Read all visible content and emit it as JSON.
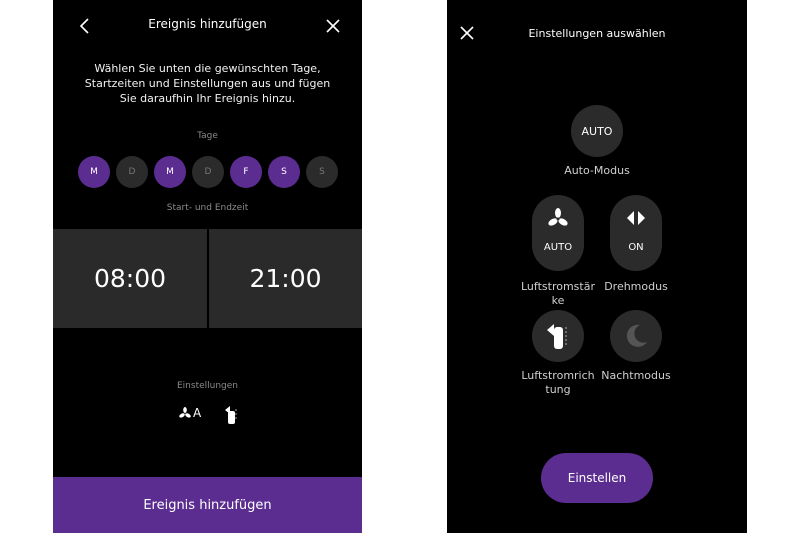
{
  "left": {
    "title": "Ereignis hinzufügen",
    "intro": "Wählen Sie unten die gewünschten Tage, Startzeiten und Einstellungen aus und fügen Sie daraufhin Ihr Ereignis hinzu.",
    "days_label": "Tage",
    "days": [
      {
        "label": "M",
        "selected": true
      },
      {
        "label": "D",
        "selected": false
      },
      {
        "label": "M",
        "selected": true
      },
      {
        "label": "D",
        "selected": false
      },
      {
        "label": "F",
        "selected": true
      },
      {
        "label": "S",
        "selected": true
      },
      {
        "label": "S",
        "selected": false
      }
    ],
    "time_label": "Start- und Endzeit",
    "start_time": "08:00",
    "end_time": "21:00",
    "settings_label": "Einstellungen",
    "settings_fan_text": "A",
    "add_button": "Ereignis hinzufügen"
  },
  "right": {
    "title": "Einstellungen auswählen",
    "auto_circle": "AUTO",
    "auto_label": "Auto-Modus",
    "airflow_value": "AUTO",
    "airflow_label_1": "Luftstromstär",
    "airflow_label_2": "ke",
    "oscillation_value": "ON",
    "oscillation_label": "Drehmodus",
    "direction_label_1": "Luftstromrich",
    "direction_label_2": "tung",
    "night_label": "Nachtmodus",
    "set_button": "Einstellen"
  },
  "colors": {
    "accent": "#5c2d91",
    "screen_bg": "#000000",
    "control_bg": "#2b2b2b",
    "time_bg": "#2a2a2a"
  }
}
